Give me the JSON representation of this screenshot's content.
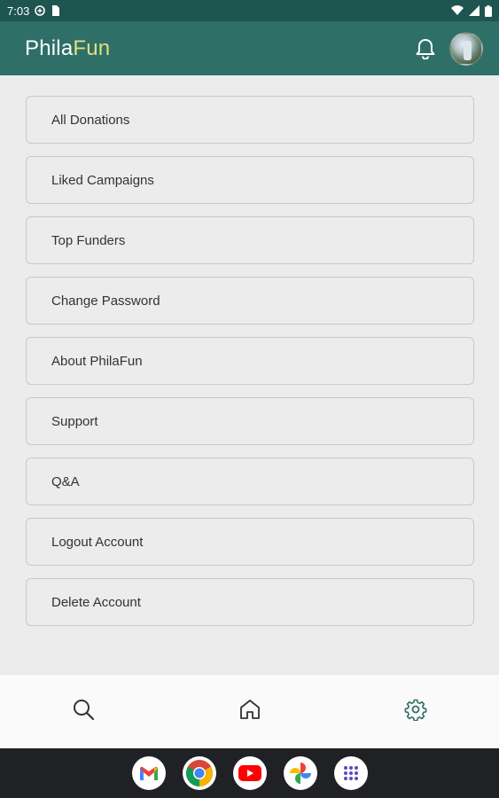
{
  "status_bar": {
    "time": "7:03",
    "icons": [
      "data-saver-icon",
      "sim-card-icon",
      "wifi-icon",
      "signal-icon",
      "battery-icon"
    ]
  },
  "app_bar": {
    "title_primary": "Phila",
    "title_accent": "Fun",
    "accent_color": "#e7dd7c",
    "background_color": "#2e7068",
    "icons": [
      "bell-icon",
      "avatar"
    ]
  },
  "menu": {
    "items": [
      {
        "label": "All Donations"
      },
      {
        "label": "Liked Campaigns"
      },
      {
        "label": "Top Funders"
      },
      {
        "label": "Change Password"
      },
      {
        "label": "About PhilaFun"
      },
      {
        "label": "Support"
      },
      {
        "label": "Q&A"
      },
      {
        "label": "Logout Account"
      },
      {
        "label": "Delete Account"
      }
    ]
  },
  "bottom_nav": {
    "items": [
      {
        "icon": "search-icon",
        "active": false
      },
      {
        "icon": "home-icon",
        "active": false
      },
      {
        "icon": "settings-gear-icon",
        "active": true
      }
    ],
    "active_color": "#2e7068"
  },
  "system_dock": {
    "apps": [
      "gmail-icon",
      "chrome-icon",
      "youtube-icon",
      "photos-icon",
      "app-drawer-icon"
    ]
  }
}
